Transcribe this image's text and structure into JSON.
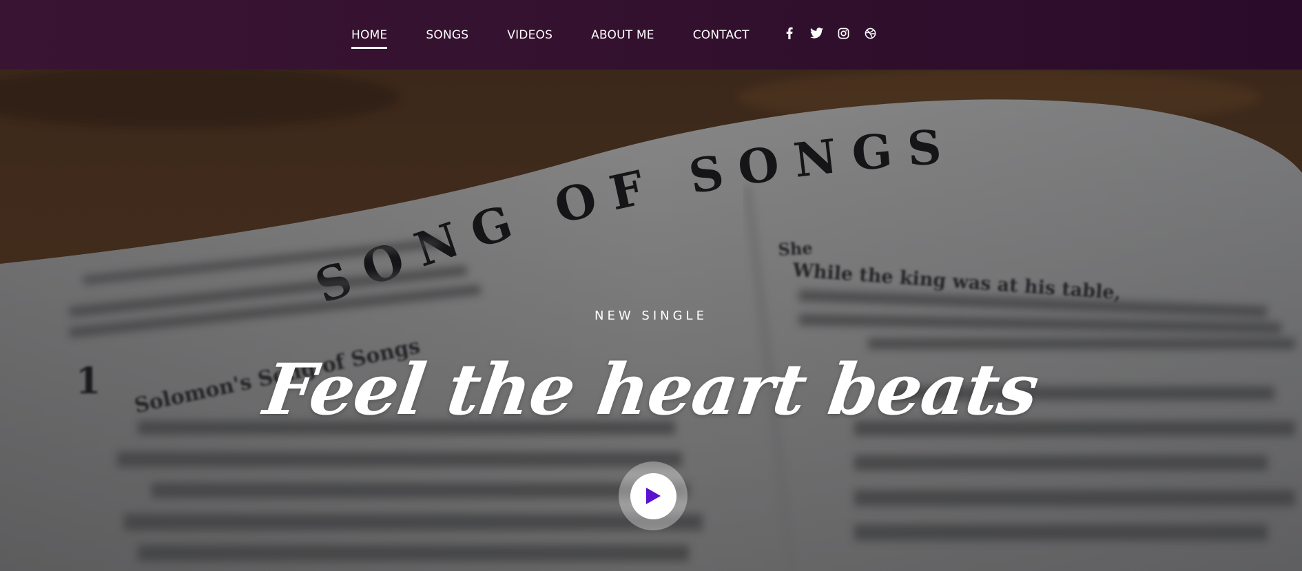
{
  "nav": {
    "items": [
      {
        "label": "HOME",
        "active": true
      },
      {
        "label": "SONGS",
        "active": false
      },
      {
        "label": "VIDEOS",
        "active": false
      },
      {
        "label": "ABOUT ME",
        "active": false
      },
      {
        "label": "CONTACT",
        "active": false
      }
    ],
    "socials": [
      "facebook-icon",
      "twitter-icon",
      "instagram-icon",
      "dribbble-icon"
    ]
  },
  "hero": {
    "background_image_text": {
      "heading": "SONG OF SONGS",
      "chapter": "1",
      "subheading": "Solomon's Song of Songs",
      "right_heading": "She",
      "right_line": "While the king was at his table,"
    },
    "kicker": "NEW SINGLE",
    "headline": "Feel the heart beats",
    "play_icon": "play-icon"
  },
  "colors": {
    "nav_bg": "#33112f",
    "accent": "#5a10d0",
    "text": "#ffffff"
  }
}
